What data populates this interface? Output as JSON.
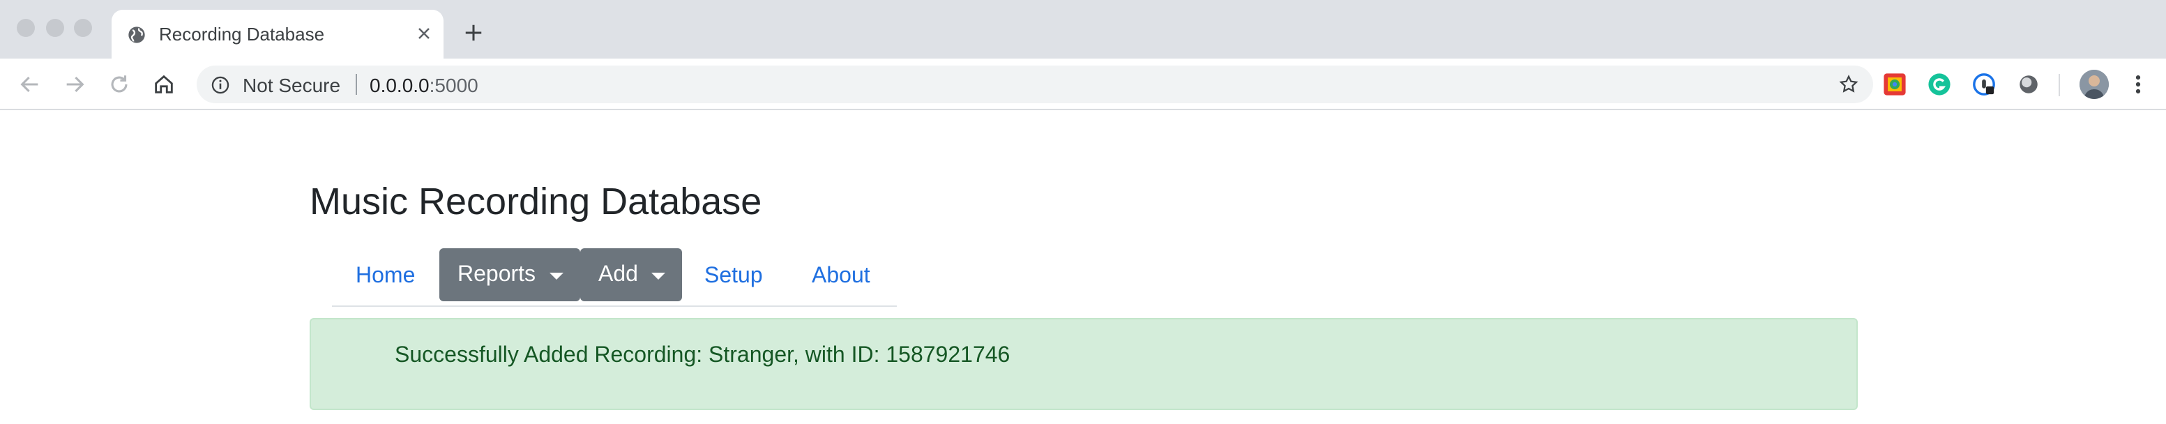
{
  "browser": {
    "tab": {
      "title": "Recording Database"
    },
    "address_bar": {
      "security_label": "Not Secure",
      "url_host": "0.0.0.0",
      "url_rest": ":5000"
    },
    "extensions": [
      "lastpass-icon",
      "grammarly-icon",
      "password-manager-icon",
      "dark-mode-icon"
    ]
  },
  "page": {
    "title": "Music Recording Database",
    "nav": {
      "home": "Home",
      "reports": "Reports",
      "add": "Add",
      "setup": "Setup",
      "about": "About"
    },
    "alert": {
      "message": "Successfully Added Recording: Stranger, with ID: 1587921746"
    }
  },
  "colors": {
    "link": "#1f6fe0",
    "dropdown_bg": "#6c757d",
    "alert_bg": "#d4edda",
    "alert_text": "#155724"
  }
}
